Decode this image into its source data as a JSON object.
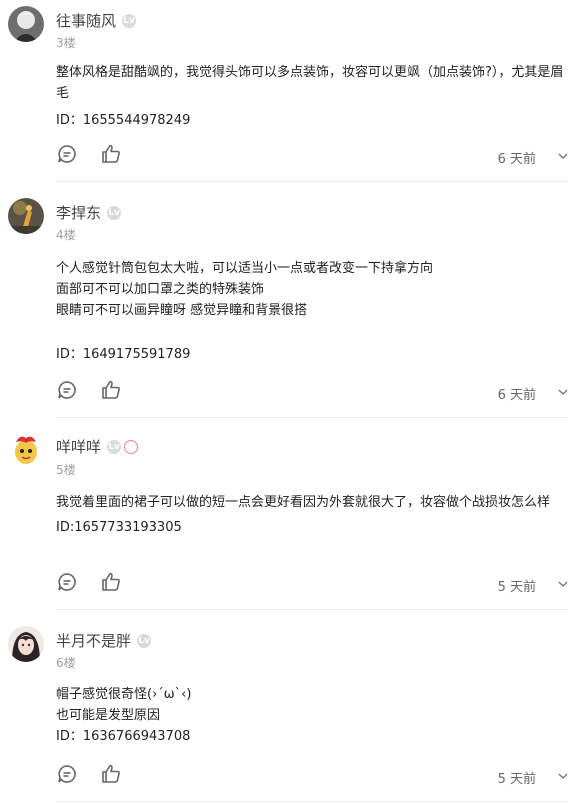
{
  "comments": [
    {
      "username": "往事随风",
      "floor": "3楼",
      "lines": [
        "整体风格是甜酷飒的，我觉得头饰可以多点装饰，妆容可以更飒（加点装饰?），尤其是眉毛",
        "ID：1655544978249"
      ],
      "time": "6 天前"
    },
    {
      "username": "李捍东",
      "floor": "4楼",
      "lines": [
        "个人感觉针筒包包太大啦，可以适当小一点或者改变一下持拿方向",
        "面部可不可以加口罩之类的特殊装饰",
        "眼睛可不可以画异瞳呀 感觉异瞳和背景很搭",
        "",
        "ID：1649175591789"
      ],
      "time": "6 天前"
    },
    {
      "username": "咩咩咩",
      "floor": "5楼",
      "lines": [
        "我觉着里面的裙子可以做的短一点会更好看因为外套就很大了，妆容做个战损妆怎么样",
        "ID:1657733193305"
      ],
      "time": "5 天前"
    },
    {
      "username": "半月不是胖",
      "floor": "6楼",
      "lines": [
        "帽子感觉很奇怪(›´ω`‹)",
        "也可能是发型原因",
        "ID：1636766943708"
      ],
      "time": "5 天前"
    }
  ],
  "badge_text": "Lv",
  "icons": {
    "reply": "comment-bubble-icon",
    "like": "thumbs-up-icon",
    "more": "more-options-icon"
  },
  "colors": {
    "divider": "#ececec",
    "meta": "#a0a0a0",
    "badge": "#d6d9de",
    "pink_badge": "#f07ea3"
  }
}
